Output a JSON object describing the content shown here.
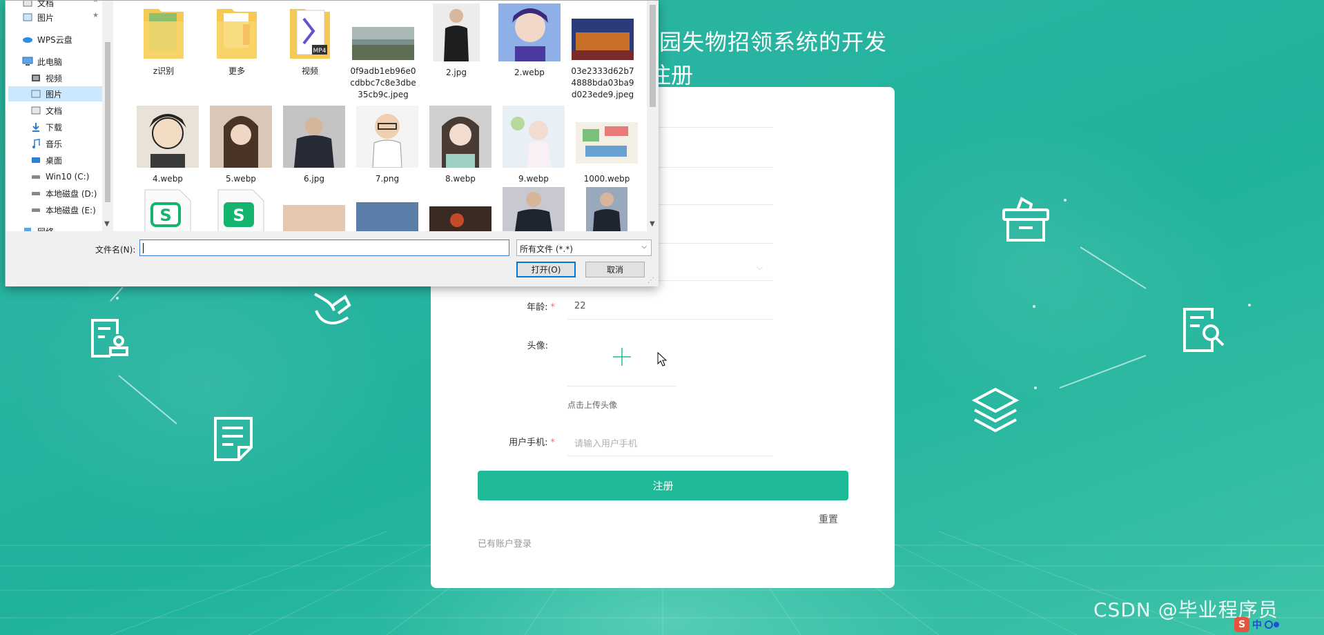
{
  "page": {
    "title_line1": "园失物招领系统的开发",
    "title_line2": "注册"
  },
  "form": {
    "age_label": "年龄:",
    "age_value": "22",
    "avatar_label": "头像:",
    "avatar_hint": "点击上传头像",
    "phone_label": "用户手机:",
    "phone_placeholder": "请输入用户手机",
    "register_button": "注册",
    "reset_link": "重置",
    "login_link": "已有账户登录",
    "required_mark": "*"
  },
  "dialog": {
    "nav_items": [
      {
        "label": "文档",
        "icon": "document-folder-icon",
        "pinned": true
      },
      {
        "label": "图片",
        "icon": "pictures-folder-icon",
        "pinned": true
      },
      {
        "label": "WPS云盘",
        "icon": "cloud-icon",
        "pinned": false
      },
      {
        "label": "此电脑",
        "icon": "computer-icon",
        "pinned": false
      },
      {
        "label": "视频",
        "icon": "video-folder-icon",
        "pinned": false
      },
      {
        "label": "图片",
        "icon": "pictures-folder-icon",
        "pinned": false,
        "selected": true
      },
      {
        "label": "文档",
        "icon": "document-folder-icon",
        "pinned": false
      },
      {
        "label": "下载",
        "icon": "download-icon",
        "pinned": false
      },
      {
        "label": "音乐",
        "icon": "music-icon",
        "pinned": false
      },
      {
        "label": "桌面",
        "icon": "desktop-icon",
        "pinned": false
      },
      {
        "label": "Win10 (C:)",
        "icon": "drive-icon",
        "pinned": false
      },
      {
        "label": "本地磁盘 (D:)",
        "icon": "drive-icon",
        "pinned": false
      },
      {
        "label": "本地磁盘 (E:)",
        "icon": "drive-icon",
        "pinned": false
      },
      {
        "label": "网络",
        "icon": "network-icon",
        "pinned": false
      }
    ],
    "files_row1": [
      {
        "name": "z识别",
        "kind": "folder"
      },
      {
        "name": "更多",
        "kind": "folder"
      },
      {
        "name": "视频",
        "kind": "folder"
      },
      {
        "name": "0f9adb1eb96e0cdbbc7c8e3dbe35cb9c.jpeg",
        "kind": "image"
      },
      {
        "name": "2.jpg",
        "kind": "image"
      },
      {
        "name": "2.webp",
        "kind": "image"
      },
      {
        "name": "03e2333d62b74888bda03ba9d023ede9.jpeg",
        "kind": "image"
      }
    ],
    "files_row2": [
      {
        "name": "4.webp",
        "kind": "image"
      },
      {
        "name": "5.webp",
        "kind": "image"
      },
      {
        "name": "6.jpg",
        "kind": "image"
      },
      {
        "name": "7.png",
        "kind": "image"
      },
      {
        "name": "8.webp",
        "kind": "image"
      },
      {
        "name": "9.webp",
        "kind": "image"
      },
      {
        "name": "1000.webp",
        "kind": "image"
      }
    ],
    "filename_label": "文件名(N):",
    "filename_value": "",
    "filetype_value": "所有文件 (*.*)",
    "open_button": "打开(O)",
    "cancel_button": "取消"
  },
  "watermark": "CSDN @毕业程序员",
  "ime": {
    "logo": "S",
    "mode": "中"
  },
  "colors": {
    "accent": "#1eb996",
    "background": "#27b4a0",
    "required": "#f56c6c",
    "selection": "#cce8ff"
  }
}
